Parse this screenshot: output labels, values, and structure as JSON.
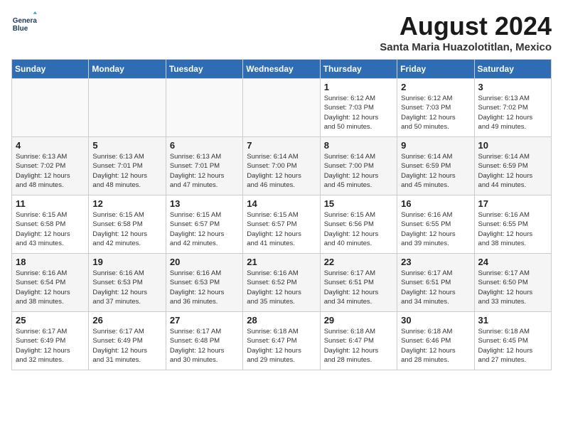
{
  "header": {
    "logo_line1": "General",
    "logo_line2": "Blue",
    "month": "August 2024",
    "location": "Santa Maria Huazolotitlan, Mexico"
  },
  "weekdays": [
    "Sunday",
    "Monday",
    "Tuesday",
    "Wednesday",
    "Thursday",
    "Friday",
    "Saturday"
  ],
  "weeks": [
    [
      {
        "day": "",
        "info": ""
      },
      {
        "day": "",
        "info": ""
      },
      {
        "day": "",
        "info": ""
      },
      {
        "day": "",
        "info": ""
      },
      {
        "day": "1",
        "info": "Sunrise: 6:12 AM\nSunset: 7:03 PM\nDaylight: 12 hours\nand 50 minutes."
      },
      {
        "day": "2",
        "info": "Sunrise: 6:12 AM\nSunset: 7:03 PM\nDaylight: 12 hours\nand 50 minutes."
      },
      {
        "day": "3",
        "info": "Sunrise: 6:13 AM\nSunset: 7:02 PM\nDaylight: 12 hours\nand 49 minutes."
      }
    ],
    [
      {
        "day": "4",
        "info": "Sunrise: 6:13 AM\nSunset: 7:02 PM\nDaylight: 12 hours\nand 48 minutes."
      },
      {
        "day": "5",
        "info": "Sunrise: 6:13 AM\nSunset: 7:01 PM\nDaylight: 12 hours\nand 48 minutes."
      },
      {
        "day": "6",
        "info": "Sunrise: 6:13 AM\nSunset: 7:01 PM\nDaylight: 12 hours\nand 47 minutes."
      },
      {
        "day": "7",
        "info": "Sunrise: 6:14 AM\nSunset: 7:00 PM\nDaylight: 12 hours\nand 46 minutes."
      },
      {
        "day": "8",
        "info": "Sunrise: 6:14 AM\nSunset: 7:00 PM\nDaylight: 12 hours\nand 45 minutes."
      },
      {
        "day": "9",
        "info": "Sunrise: 6:14 AM\nSunset: 6:59 PM\nDaylight: 12 hours\nand 45 minutes."
      },
      {
        "day": "10",
        "info": "Sunrise: 6:14 AM\nSunset: 6:59 PM\nDaylight: 12 hours\nand 44 minutes."
      }
    ],
    [
      {
        "day": "11",
        "info": "Sunrise: 6:15 AM\nSunset: 6:58 PM\nDaylight: 12 hours\nand 43 minutes."
      },
      {
        "day": "12",
        "info": "Sunrise: 6:15 AM\nSunset: 6:58 PM\nDaylight: 12 hours\nand 42 minutes."
      },
      {
        "day": "13",
        "info": "Sunrise: 6:15 AM\nSunset: 6:57 PM\nDaylight: 12 hours\nand 42 minutes."
      },
      {
        "day": "14",
        "info": "Sunrise: 6:15 AM\nSunset: 6:57 PM\nDaylight: 12 hours\nand 41 minutes."
      },
      {
        "day": "15",
        "info": "Sunrise: 6:15 AM\nSunset: 6:56 PM\nDaylight: 12 hours\nand 40 minutes."
      },
      {
        "day": "16",
        "info": "Sunrise: 6:16 AM\nSunset: 6:55 PM\nDaylight: 12 hours\nand 39 minutes."
      },
      {
        "day": "17",
        "info": "Sunrise: 6:16 AM\nSunset: 6:55 PM\nDaylight: 12 hours\nand 38 minutes."
      }
    ],
    [
      {
        "day": "18",
        "info": "Sunrise: 6:16 AM\nSunset: 6:54 PM\nDaylight: 12 hours\nand 38 minutes."
      },
      {
        "day": "19",
        "info": "Sunrise: 6:16 AM\nSunset: 6:53 PM\nDaylight: 12 hours\nand 37 minutes."
      },
      {
        "day": "20",
        "info": "Sunrise: 6:16 AM\nSunset: 6:53 PM\nDaylight: 12 hours\nand 36 minutes."
      },
      {
        "day": "21",
        "info": "Sunrise: 6:16 AM\nSunset: 6:52 PM\nDaylight: 12 hours\nand 35 minutes."
      },
      {
        "day": "22",
        "info": "Sunrise: 6:17 AM\nSunset: 6:51 PM\nDaylight: 12 hours\nand 34 minutes."
      },
      {
        "day": "23",
        "info": "Sunrise: 6:17 AM\nSunset: 6:51 PM\nDaylight: 12 hours\nand 34 minutes."
      },
      {
        "day": "24",
        "info": "Sunrise: 6:17 AM\nSunset: 6:50 PM\nDaylight: 12 hours\nand 33 minutes."
      }
    ],
    [
      {
        "day": "25",
        "info": "Sunrise: 6:17 AM\nSunset: 6:49 PM\nDaylight: 12 hours\nand 32 minutes."
      },
      {
        "day": "26",
        "info": "Sunrise: 6:17 AM\nSunset: 6:49 PM\nDaylight: 12 hours\nand 31 minutes."
      },
      {
        "day": "27",
        "info": "Sunrise: 6:17 AM\nSunset: 6:48 PM\nDaylight: 12 hours\nand 30 minutes."
      },
      {
        "day": "28",
        "info": "Sunrise: 6:18 AM\nSunset: 6:47 PM\nDaylight: 12 hours\nand 29 minutes."
      },
      {
        "day": "29",
        "info": "Sunrise: 6:18 AM\nSunset: 6:47 PM\nDaylight: 12 hours\nand 28 minutes."
      },
      {
        "day": "30",
        "info": "Sunrise: 6:18 AM\nSunset: 6:46 PM\nDaylight: 12 hours\nand 28 minutes."
      },
      {
        "day": "31",
        "info": "Sunrise: 6:18 AM\nSunset: 6:45 PM\nDaylight: 12 hours\nand 27 minutes."
      }
    ]
  ]
}
